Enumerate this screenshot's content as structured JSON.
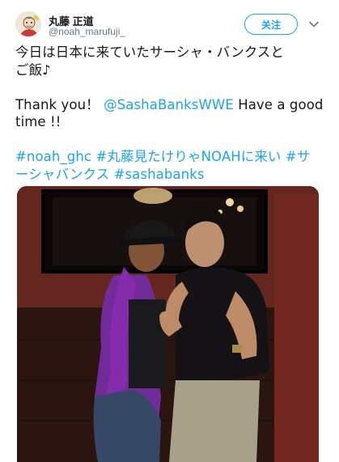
{
  "user": {
    "display_name": "丸藤 正道",
    "screen_name": "@noah_marufuji_",
    "follow_label": "关注"
  },
  "tweet": {
    "line1": "今日は日本に来ていたサーシャ・バンクスと",
    "line2": "ご飯♪",
    "thank_prefix": "Thank you！",
    "mention": "@SashaBanksWWE",
    "thank_suffix": " Have a good",
    "line4": "time !!",
    "hashtag1": "#noah_ghc",
    "hashtag2": "#丸藤見たけりゃNOAHに来い",
    "hashtag3_part1": "#サ",
    "hashtag3_part2": "ーシャバンクス",
    "hashtag4": "#sashabanks"
  },
  "colors": {
    "accent": "#1da1f2",
    "text": "#14171a",
    "secondary": "#657786"
  },
  "icons": {
    "caret": "chevron-down-icon",
    "avatar": "avatar-illustration"
  }
}
